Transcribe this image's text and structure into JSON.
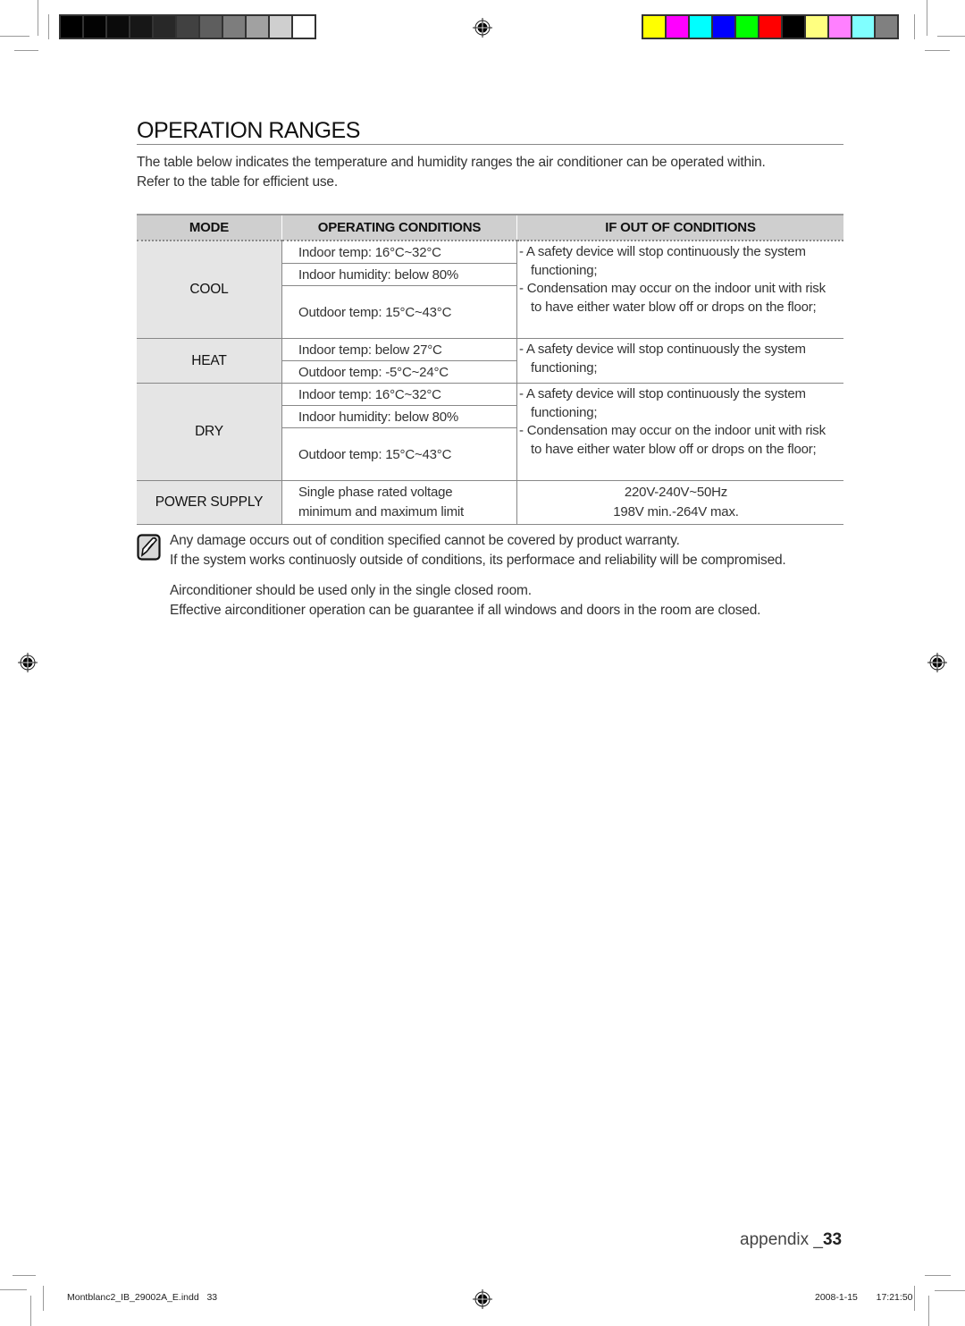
{
  "page": {
    "title": "OPERATION RANGES",
    "intro": [
      "The table below indicates the temperature and humidity ranges the air conditioner can be operated within.",
      "Refer to the table for efficient use."
    ]
  },
  "print_marks": {
    "gray_swatches": [
      "#000000",
      "#030303",
      "#0b0b0b",
      "#171717",
      "#282828",
      "#414141",
      "#5e5e5e",
      "#7d7d7d",
      "#a1a1a1",
      "#cfcfcf",
      "#ffffff"
    ],
    "color_swatches": [
      "#ffff00",
      "#ff00ff",
      "#00ffff",
      "#0000ff",
      "#00ff00",
      "#ff0000",
      "#000000",
      "#ffff80",
      "#ff80ff",
      "#80ffff",
      "#808080"
    ]
  },
  "table": {
    "headers": [
      "MODE",
      "OPERATING CONDITIONS",
      "IF OUT OF CONDITIONS"
    ],
    "rows": [
      {
        "mode": "COOL",
        "conditions": [
          "Indoor temp: 16°C~32°C",
          "Indoor humidity: below 80%",
          "Outdoor temp: 15°C~43°C"
        ],
        "out": [
          "- A safety device will stop continuously the system functioning;",
          "- Condensation may occur on the indoor unit with risk to have either water blow off or drops on the floor;"
        ]
      },
      {
        "mode": "HEAT",
        "conditions": [
          "Indoor temp: below 27°C",
          "Outdoor temp: -5°C~24°C"
        ],
        "out": [
          "- A safety device will stop continuously the system functioning;"
        ]
      },
      {
        "mode": "DRY",
        "conditions": [
          "Indoor temp: 16°C~32°C",
          "Indoor humidity: below 80%",
          "Outdoor temp: 15°C~43°C"
        ],
        "out": [
          "- A safety device will stop continuously the system functioning;",
          "- Condensation may occur on the indoor unit with risk to have either water blow off or drops on the floor;"
        ]
      },
      {
        "mode": "POWER SUPPLY",
        "conditions": [
          "Single phase rated voltage",
          "minimum and maximum limit"
        ],
        "out": [
          "220V-240V~50Hz",
          "198V min.-264V max."
        ]
      }
    ]
  },
  "notes": {
    "icon": "note-pencil-icon",
    "lines": [
      "Any damage occurs out of condition specified cannot be covered by product warranty.",
      "If the system works continuosly outside of conditions, its performace and reliability will be compromised.",
      "Airconditioner should be used only in the single closed room.",
      "Effective airconditioner operation can be guarantee if all windows and doors in the room are closed."
    ]
  },
  "footer": {
    "section": "appendix _",
    "page_number": "33",
    "slug": "Montblanc2_IB_29002A_E.indd   33",
    "timestamp": "2008-1-15   17:21:50"
  }
}
